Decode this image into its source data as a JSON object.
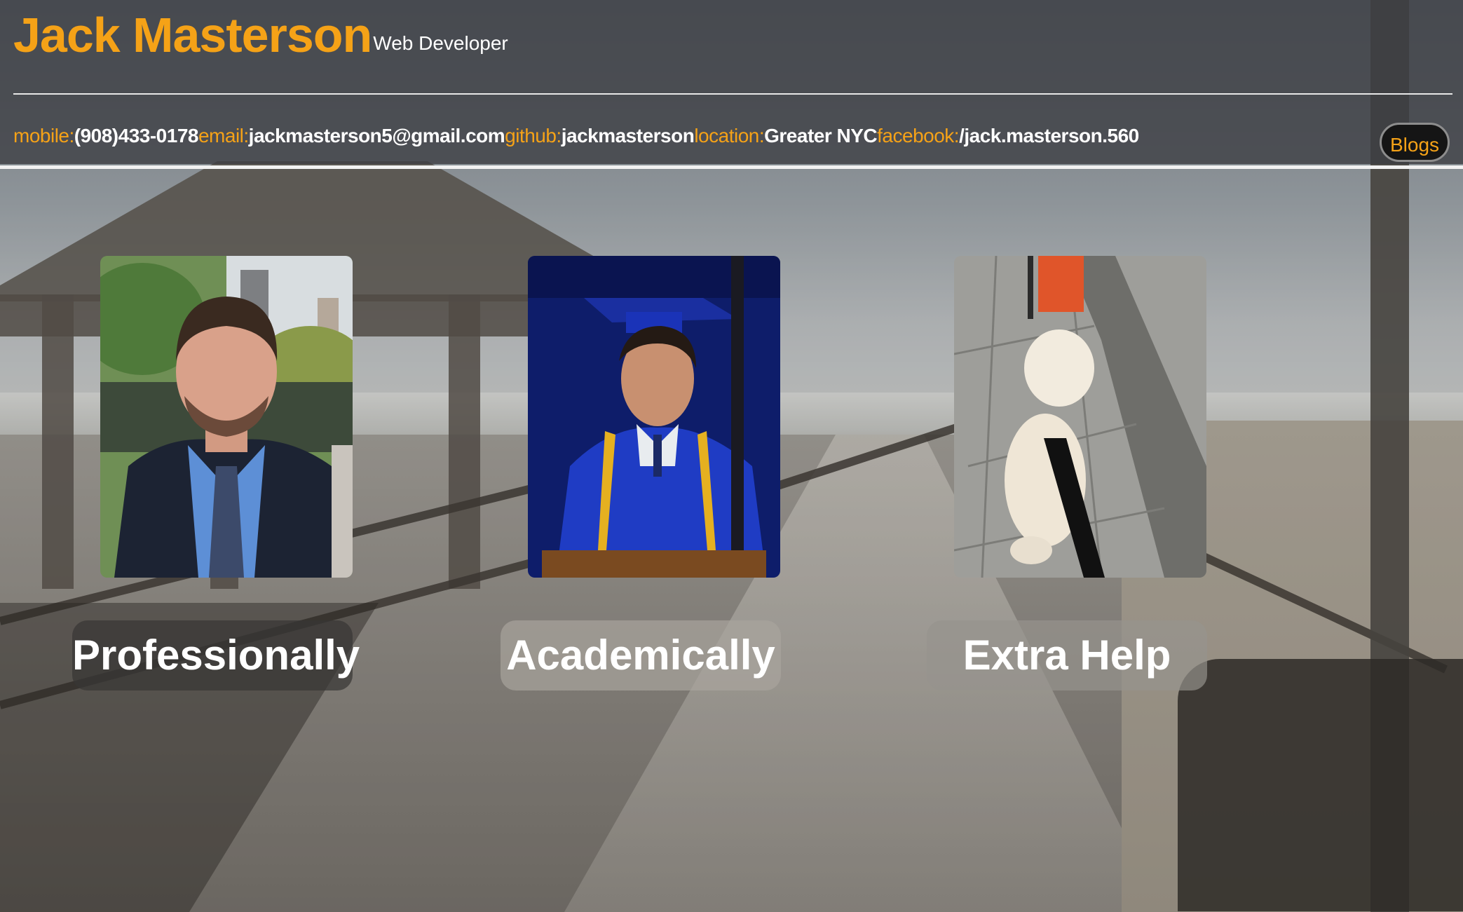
{
  "header": {
    "name": "Jack Masterson",
    "role": "Web Developer",
    "contact": [
      {
        "key": "mobile:",
        "value": "(908)433-0178"
      },
      {
        "key": "email:",
        "value": "jackmasterson5@gmail.com"
      },
      {
        "key": "github:",
        "value": "jackmasterson"
      },
      {
        "key": "location:",
        "value": "Greater NYC"
      },
      {
        "key": "facebook:",
        "value": "/jack.masterson.560"
      }
    ],
    "blogs_label": "Blogs"
  },
  "cards": [
    {
      "label": "Professionally"
    },
    {
      "label": "Academically"
    },
    {
      "label": "Extra Help"
    }
  ],
  "colors": {
    "accent": "#f5a217",
    "header_bg": "#3c3e42",
    "text": "#ffffff"
  }
}
